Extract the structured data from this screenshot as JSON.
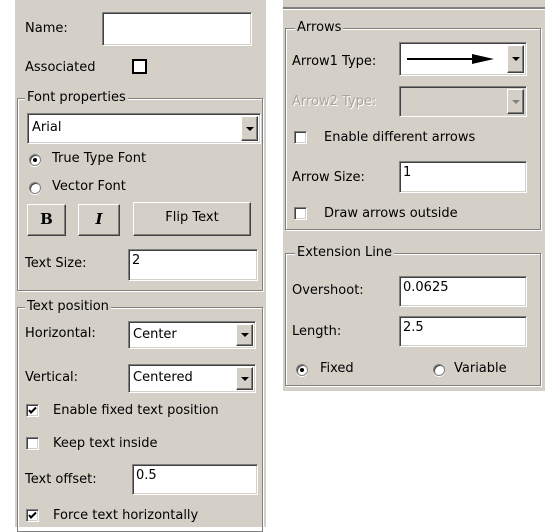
{
  "left": {
    "name_label": "Name:",
    "name_value": "",
    "associated_label": "Associated",
    "associated_checked": false,
    "font_group": {
      "title": "Font properties",
      "font_value": "Arial",
      "truetype_label": "True Type Font",
      "vector_label": "Vector Font",
      "selected": "truetype",
      "bold_label": "B",
      "italic_label": "I",
      "flip_label": "Flip Text",
      "textsize_label": "Text Size:",
      "textsize_value": "2"
    },
    "position_group": {
      "title": "Text position",
      "horizontal_label": "Horizontal:",
      "horizontal_value": "Center",
      "vertical_label": "Vertical:",
      "vertical_value": "Centered",
      "fixed_label": "Enable fixed text position",
      "fixed_checked": true,
      "inside_label": "Keep text inside",
      "inside_checked": false,
      "offset_label": "Text offset:",
      "offset_value": "0.5",
      "force_label": "Force text horizontally",
      "force_checked": true
    }
  },
  "right": {
    "arrows_group": {
      "title": "Arrows",
      "arrow1_label": "Arrow1 Type:",
      "arrow2_label": "Arrow2 Type:",
      "diff_label": "Enable different arrows",
      "diff_checked": false,
      "size_label": "Arrow Size:",
      "size_value": "1",
      "outside_label": "Draw arrows outside",
      "outside_checked": false
    },
    "extension_group": {
      "title": "Extension Line",
      "overshoot_label": "Overshoot:",
      "overshoot_value": "0.0625",
      "length_label": "Length:",
      "length_value": "2.5",
      "fixed_label": "Fixed",
      "variable_label": "Variable",
      "selected": "fixed"
    }
  }
}
